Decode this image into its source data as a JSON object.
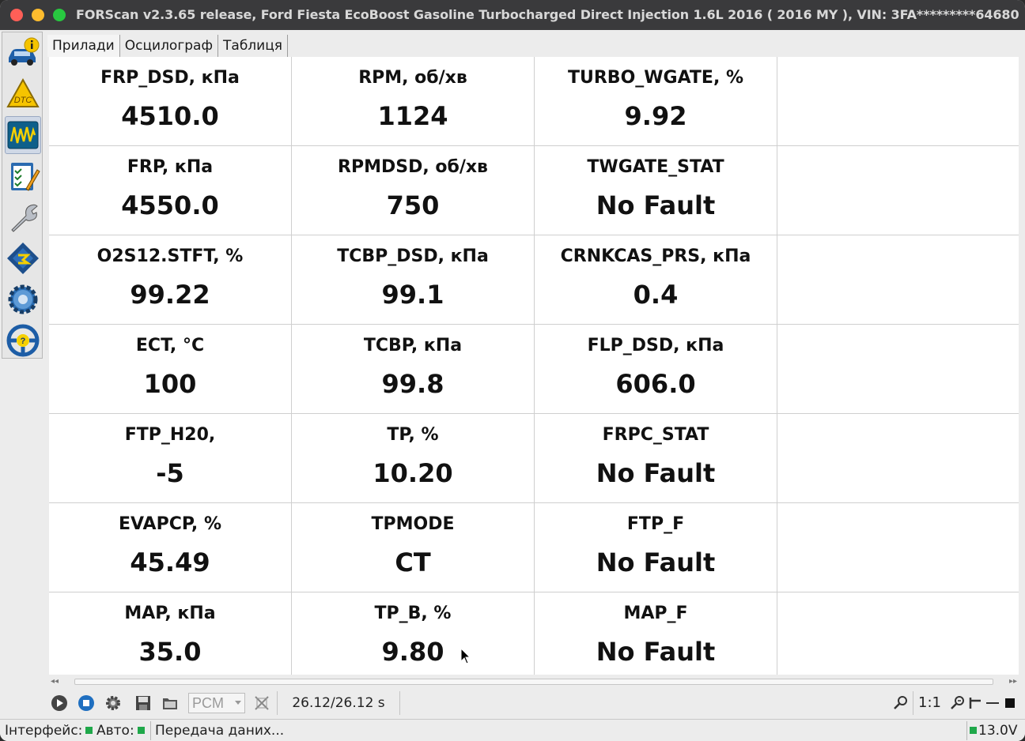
{
  "window": {
    "title": "FORScan v2.3.65 release, Ford Fiesta EcoBoost Gasoline Turbocharged Direct Injection 1.6L 2016 ( 2016 MY ), VIN: 3FA*********64680"
  },
  "sidebar": {
    "items": [
      {
        "name": "vehicle-info",
        "icon": "car-info-icon"
      },
      {
        "name": "dtc",
        "icon": "dtc-warning-icon",
        "icon_text": "DTC"
      },
      {
        "name": "oscilloscope",
        "icon": "oscilloscope-icon"
      },
      {
        "name": "tests",
        "icon": "checklist-icon"
      },
      {
        "name": "service",
        "icon": "wrench-icon"
      },
      {
        "name": "configuration",
        "icon": "chip-icon"
      },
      {
        "name": "settings",
        "icon": "gear-icon"
      },
      {
        "name": "help",
        "icon": "help-steering-icon"
      }
    ],
    "active_index": 2
  },
  "tabs": [
    {
      "label": "Прилади",
      "active": true
    },
    {
      "label": "Осцилограф",
      "active": false
    },
    {
      "label": "Таблиця",
      "active": false
    }
  ],
  "grid": {
    "rows": [
      [
        {
          "label": "FRP_DSD, кПа",
          "value": "4510.0"
        },
        {
          "label": "RPM, об/хв",
          "value": "1124"
        },
        {
          "label": "TURBO_WGATE, %",
          "value": "9.92"
        }
      ],
      [
        {
          "label": "FRP, кПа",
          "value": "4550.0"
        },
        {
          "label": "RPMDSD, об/хв",
          "value": "750"
        },
        {
          "label": "TWGATE_STAT",
          "value": "No Fault"
        }
      ],
      [
        {
          "label": "O2S12.STFT, %",
          "value": "99.22"
        },
        {
          "label": "TCBP_DSD, кПа",
          "value": "99.1"
        },
        {
          "label": "CRNKCAS_PRS, кПа",
          "value": "0.4"
        }
      ],
      [
        {
          "label": "ECT, °C",
          "value": "100"
        },
        {
          "label": "TCBP, кПа",
          "value": "99.8"
        },
        {
          "label": "FLP_DSD, кПа",
          "value": "606.0"
        }
      ],
      [
        {
          "label": "FTP_H20,",
          "value": "-5"
        },
        {
          "label": "TP, %",
          "value": "10.20"
        },
        {
          "label": "FRPC_STAT",
          "value": "No Fault"
        }
      ],
      [
        {
          "label": "EVAPCP, %",
          "value": "45.49"
        },
        {
          "label": "TPMODE",
          "value": "CT"
        },
        {
          "label": "FTP_F",
          "value": "No Fault"
        }
      ],
      [
        {
          "label": "MAP, кПа",
          "value": "35.0"
        },
        {
          "label": "TP_B, %",
          "value": "9.80"
        },
        {
          "label": "MAP_F",
          "value": "No Fault"
        }
      ]
    ]
  },
  "toolbar": {
    "play_icon": "play-icon",
    "stop_icon": "stop-icon",
    "settings_icon": "gear-icon",
    "save_icon": "save-icon",
    "open_icon": "open-folder-icon",
    "module_select_value": "PCM",
    "clear_icon": "clear-icon",
    "time": "26.12/26.12 s",
    "zoom_ratio": "1:1"
  },
  "statusbar": {
    "interface_label": "Інтерфейс:",
    "auto_label": "Авто:",
    "message": "Передача даних...",
    "voltage": "13.0V",
    "led_color": "#1fa84a"
  }
}
